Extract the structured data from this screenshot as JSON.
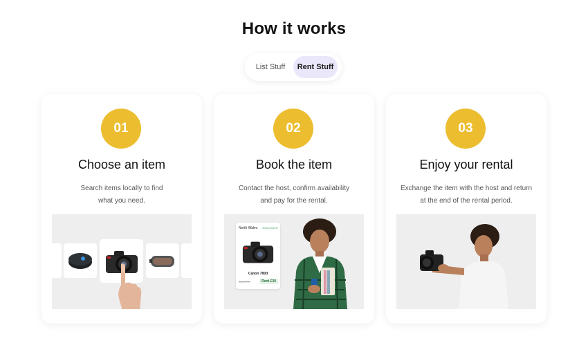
{
  "section": {
    "title": "How it works"
  },
  "toggle": {
    "options": [
      "List Stuff",
      "Rent Stuff"
    ],
    "selected": "Rent Stuff"
  },
  "colors": {
    "badge": "#ecbd2f",
    "toggle_active": "#ebe7fb",
    "image_bg": "#eeeeee"
  },
  "steps": [
    {
      "number": "01",
      "title": "Choose an item",
      "desc_line1": "Search items locally to find",
      "desc_line2": "what you need."
    },
    {
      "number": "02",
      "title": "Book the item",
      "desc_line1": "Contact the host, confirm availability",
      "desc_line2": "and pay for the rental."
    },
    {
      "number": "03",
      "title": "Enjoy your rental",
      "desc_line1": "Exchange the item with the host and return",
      "desc_line2": "at the end of the rental period."
    }
  ],
  "product_card": {
    "location": "North Wales",
    "status": "AVAILABLE",
    "name": "Canon 780d",
    "buy_price": "Buy £599",
    "rent_price": "Rent £30"
  }
}
